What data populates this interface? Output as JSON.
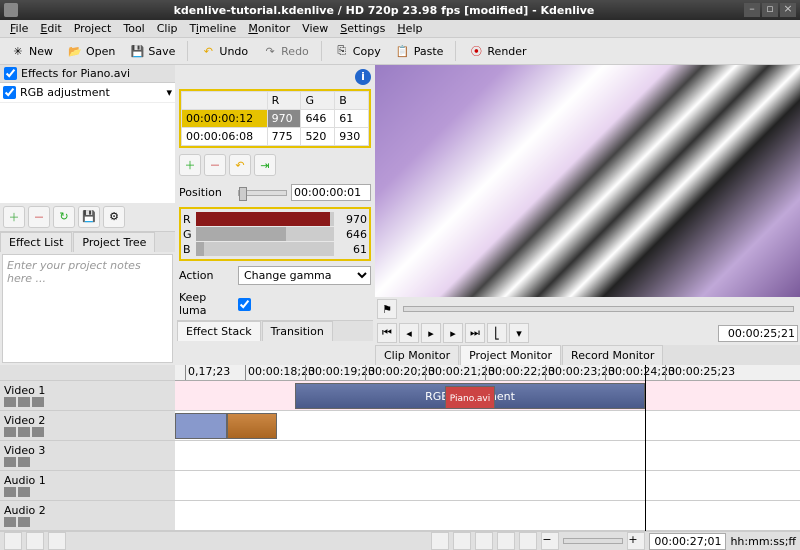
{
  "titlebar": {
    "title": "kdenlive-tutorial.kdenlive / HD 720p 23.98 fps [modified] - Kdenlive"
  },
  "menu": {
    "file": "File",
    "edit": "Edit",
    "project": "Project",
    "tool": "Tool",
    "clip": "Clip",
    "timeline": "Timeline",
    "monitor": "Monitor",
    "view": "View",
    "settings": "Settings",
    "help": "Help"
  },
  "toolbar": {
    "new": "New",
    "open": "Open",
    "save": "Save",
    "undo": "Undo",
    "redo": "Redo",
    "copy": "Copy",
    "paste": "Paste",
    "render": "Render"
  },
  "effects": {
    "header": "Effects for Piano.avi",
    "item": "RGB adjustment"
  },
  "notes_placeholder": "Enter your project notes here ...",
  "keyframes": {
    "cols": {
      "r": "R",
      "g": "G",
      "b": "B"
    },
    "rows": [
      {
        "time": "00:00:00:12",
        "r": "970",
        "g": "646",
        "b": "61"
      },
      {
        "time": "00:00:06:08",
        "r": "775",
        "g": "520",
        "b": "930"
      }
    ]
  },
  "position": {
    "label": "Position",
    "value": "00:00:00:01"
  },
  "rgb": {
    "r": {
      "label": "R",
      "value": "970"
    },
    "g": {
      "label": "G",
      "value": "646"
    },
    "b": {
      "label": "B",
      "value": "61"
    }
  },
  "action": {
    "label": "Action",
    "value": "Change gamma"
  },
  "keepluma": {
    "label": "Keep luma"
  },
  "mid_tabs": {
    "effect_stack": "Effect Stack",
    "transition": "Transition"
  },
  "left_tabs": {
    "effect_list": "Effect List",
    "project_tree": "Project Tree"
  },
  "monitor": {
    "time": "00:00:25;21",
    "tabs": {
      "clip": "Clip Monitor",
      "project": "Project Monitor",
      "record": "Record Monitor"
    }
  },
  "timeline": {
    "tracks": {
      "v1": "Video 1",
      "v2": "Video 2",
      "v3": "Video 3",
      "a1": "Audio 1",
      "a2": "Audio 2"
    },
    "ruler": [
      "0,17;23",
      "00:00:18;23",
      "00:00:19;23",
      "00:00:20;23",
      "00:00:21;23",
      "00:00:22;23",
      "00:00:23;23",
      "00:00:24;23",
      "00:00:25;23"
    ],
    "clip_piano": "Piano.avi",
    "clip_effect": "RGB adjustment"
  },
  "status": {
    "time": "00:00:27;01",
    "format": "hh:mm:ss;ff"
  }
}
